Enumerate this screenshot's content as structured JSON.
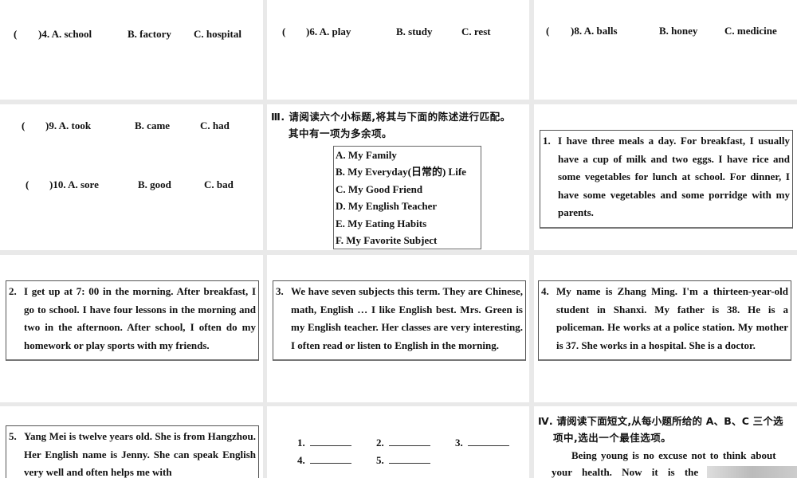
{
  "q4": {
    "paren": "(",
    "num": ")4. A. school",
    "b": "B. factory",
    "c": "C. hospital"
  },
  "q6": {
    "paren": "(",
    "num": ")6. A. play",
    "b": "B. study",
    "c": "C. rest"
  },
  "q8": {
    "paren": "(",
    "num": ")8. A. balls",
    "b": "B. honey",
    "c": "C. medicine"
  },
  "q9": {
    "paren": "(",
    "num": ")9. A. took",
    "b": "B. came",
    "c": "C. had"
  },
  "q10": {
    "paren": "(",
    "num": ")10. A. sore",
    "b": "B. good",
    "c": "C. bad"
  },
  "section3": {
    "line1": "Ⅲ. 请阅读六个小标题,将其与下面的陈述进行匹配。",
    "line2": "其中有一项为多余项。",
    "options": [
      "A. My Family",
      "B. My Everyday(日常的) Life",
      "C. My Good Friend",
      "D. My English Teacher",
      "E. My Eating Habits",
      "F. My Favorite Subject"
    ]
  },
  "passages": [
    {
      "num": "1.",
      "text": "I have three meals a day. For breakfast, I usually have a cup of milk and two eggs. I have rice and some vegetables for lunch at school. For dinner, I have some vegetables and some porridge with my parents."
    },
    {
      "num": "2.",
      "text": "I get up at 7: 00 in the morning. After breakfast, I go to school. I have four lessons in the morning and two in the afternoon. After school, I often do my homework or play sports with my friends."
    },
    {
      "num": "3.",
      "text": "We have seven subjects this term. They are Chinese, math, English … I like English best. Mrs. Green is my English teacher. Her classes are very interesting. I often read or listen to English in the morning."
    },
    {
      "num": "4.",
      "text": "My name is Zhang Ming. I'm a thirteen-year-old student in Shanxi. My father is 38. He is a policeman. He works at a police station. My mother is 37. She works in a hospital. She is a doctor."
    },
    {
      "num": "5.",
      "text": "Yang Mei is twelve years old. She is from Hangzhou. Her English name is Jenny. She can speak English very well and often helps me with"
    }
  ],
  "answers": [
    "1.",
    "2.",
    "3.",
    "4.",
    "5."
  ],
  "section4": {
    "line1": "Ⅳ. 请阅读下面短文,从每小题所给的 A、B、C 三个选",
    "line2": "项中,选出一个最佳选项。",
    "p1": "Being young is no excuse not to think about",
    "p2": "your health. Now it is the"
  }
}
